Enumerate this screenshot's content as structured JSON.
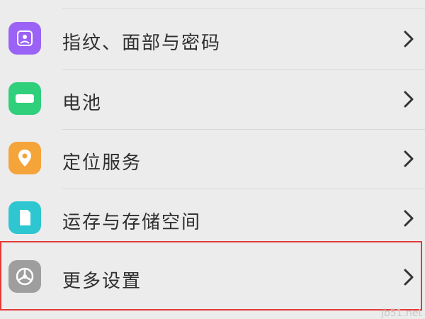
{
  "settings": {
    "items": [
      {
        "label": "指纹、面部与密码",
        "icon": "fingerprint-face-icon",
        "color": "#9b63f5"
      },
      {
        "label": "电池",
        "icon": "battery-icon",
        "color": "#2fcf7b"
      },
      {
        "label": "定位服务",
        "icon": "location-pin-icon",
        "color": "#f5a43a"
      },
      {
        "label": "运存与存储空间",
        "icon": "storage-icon",
        "color": "#2dc6d1"
      },
      {
        "label": "更多设置",
        "icon": "more-settings-icon",
        "color": "#9e9e9e"
      }
    ]
  },
  "watermark": "jb51.net",
  "colors": {
    "highlight": "#e53935",
    "background": "#ececec"
  }
}
